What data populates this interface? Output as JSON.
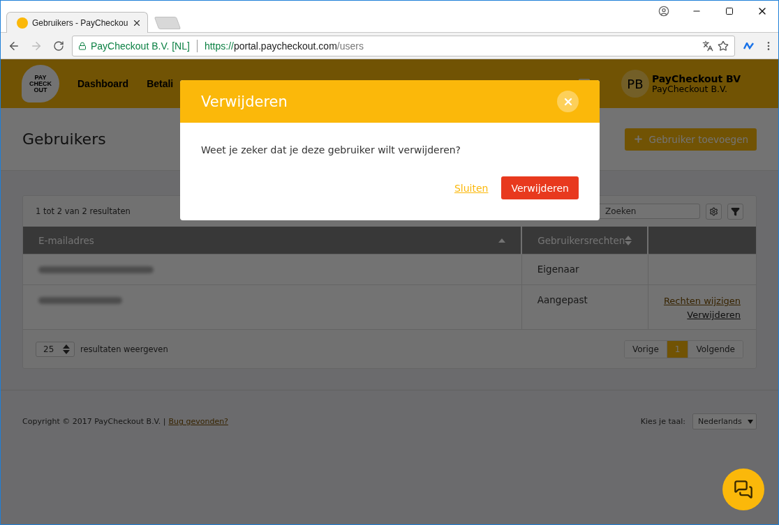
{
  "browser": {
    "tab_title": "Gebruikers - PayCheckou",
    "site_identity": "PayCheckout B.V. [NL]",
    "url": {
      "scheme": "https://",
      "host": "portal.paycheckout.com",
      "path": "/users"
    }
  },
  "header": {
    "logo_lines": [
      "PAY",
      "CHECK",
      "OUT"
    ],
    "nav": [
      "Dashboard",
      "Betali"
    ],
    "account": {
      "initials": "PB",
      "name": "PayCheckout BV",
      "company": "PayCheckout B.V."
    }
  },
  "page": {
    "title": "Gebruikers",
    "add_button": "Gebruiker toevoegen"
  },
  "table": {
    "summary": "1 tot 2 van 2 resultaten",
    "search_placeholder": "Zoeken",
    "columns": [
      {
        "label": "E-mailadres",
        "sorted": true
      },
      {
        "label": "Gebruikersrechten",
        "sorted": false
      }
    ],
    "rows": [
      {
        "email": {
          "kind": "blurred"
        },
        "rights": "Eigenaar",
        "actions": []
      },
      {
        "email": {
          "kind": "blurred"
        },
        "rights": "Aangepast",
        "actions": [
          {
            "label": "Rechten wijzigen",
            "kind": "edit"
          },
          {
            "label": "Verwijderen",
            "kind": "delete"
          }
        ]
      }
    ],
    "page_size": "25",
    "page_size_label": "resultaten weergeven",
    "pagination": [
      {
        "label": "Vorige",
        "selected": false
      },
      {
        "label": "1",
        "selected": true
      },
      {
        "label": "Volgende",
        "selected": false
      }
    ]
  },
  "footer": {
    "copyright": "Copyright © 2017 PayCheckout B.V. |",
    "bug_link": "Bug gevonden?",
    "language_label": "Kies je taal:",
    "language": "Nederlands"
  },
  "dialog": {
    "title": "Verwijderen",
    "message": "Weet je zeker dat je deze gebruiker wilt verwijderen?",
    "cancel": "Sluiten",
    "confirm": "Verwijderen"
  }
}
